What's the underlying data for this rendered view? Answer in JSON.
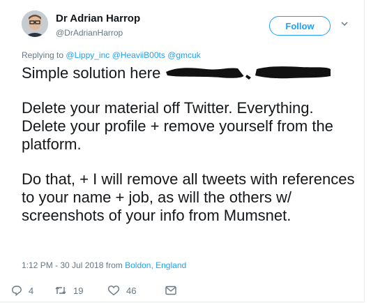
{
  "tweet": {
    "author_name": "Dr Adrian Harrop",
    "author_handle": "@DrAdrianHarrop",
    "follow_label": "Follow",
    "replying_prefix": "Replying to",
    "replying_mentions": [
      "@Lippy_inc",
      "@HeaviiB00ts",
      "@gmcuk"
    ],
    "paragraph_1": "Simple solution here",
    "paragraph_2": "Delete your material off Twitter. Everything. Delete your profile + remove yourself from the platform.",
    "paragraph_3": "Do that, + I will remove all tweets with references to your name + job, as will the others w/ screenshots of your info from Mumsnet.",
    "timestamp": "1:12 PM - 30 Jul 2018 from",
    "location": "Boldon, England"
  },
  "actions": {
    "reply_count": "4",
    "retweet_count": "19",
    "like_count": "46"
  },
  "colors": {
    "accent": "#1da1f2",
    "secondary_text": "#657786",
    "primary_text": "#14171a"
  },
  "icons": [
    "chevron-down-icon",
    "reply-icon",
    "retweet-icon",
    "like-icon",
    "message-icon"
  ]
}
